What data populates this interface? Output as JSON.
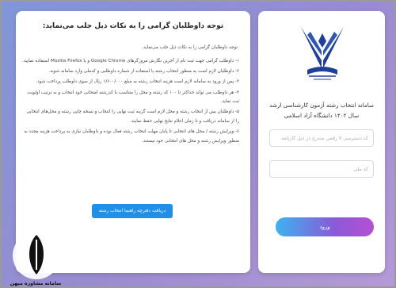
{
  "login": {
    "title": "سامانه انتخاب رشته آزمون کارشناسی ارشد سال ۱۴۰۲ دانشگاه آزاد اسلامی",
    "captcha_placeholder": "کد دسترسی ۷ رقمی مندرج در ذیل کارنامه",
    "code_placeholder": "کد ملی",
    "submit_label": "ورود",
    "logo_icon": "azad-university-logo-icon"
  },
  "notice": {
    "title": "توجه داوطلبان گرامی را به نکات ذیل جلب می‌نماید:",
    "intro": "توجه داوطلبان گرامی را به نکات ذیل جلب می‌نماید.",
    "items": [
      "۱- داوطلب گرامی جهت ثبت نام از آخرین نگارش مرورگرهای Google Chrome و یا Mozilla Firefox استفاده نمایید.",
      "۲- داوطلبان لازم است به منظور انتخاب رشته با استفاده از شماره داوطلبی و کدملی وارد سامانه شوند.",
      "۳- پس از ورود به سامانه لازم است هزینه انتخاب رشته به مبلغ ۱/۶۰۰/۰۰۰ ریال از سوی داوطلب پرداخت شود.",
      "۴- هر داوطلب می تواند حداکثر تا ۱۰۰ کد رشته و محل را متناسب با کدرشته امتحانی خود انتخاب و به ترتیب اولویت ثبت نماید.",
      "۵- داوطلبان پس از انتخاب رشته و محل لازم است گزینه ثبت نهایی را انتخاب و نسخه چاپی رشته و محل‌های انتخابی را از سامانه دریافت و تا زمان اعلام نتایج نهایی حفظ نمایند.",
      "۶- ویرایش رشته / محل های انتخابی تا پایان مهلت انتخاب رشته فعال بوده و داوطلبان نیازی به پرداخت هزینه مجدد به منظور ویرایش رشته و محل های انتخابی خود نیستند."
    ],
    "guide_button_label": "دریافت دفترچه راهنما انتخاب رشته"
  },
  "watermark": {
    "text": "سامانه مشاوره میهن",
    "icon": "mihan-watermark-icon"
  },
  "colors": {
    "background_start": "#7f97d8",
    "background_end": "#b59ad6",
    "logo_blue": "#1f3f9a",
    "guide_button": "#1f8fe8",
    "login_button_start": "#3db2f0",
    "login_button_end": "#b64fd3"
  }
}
